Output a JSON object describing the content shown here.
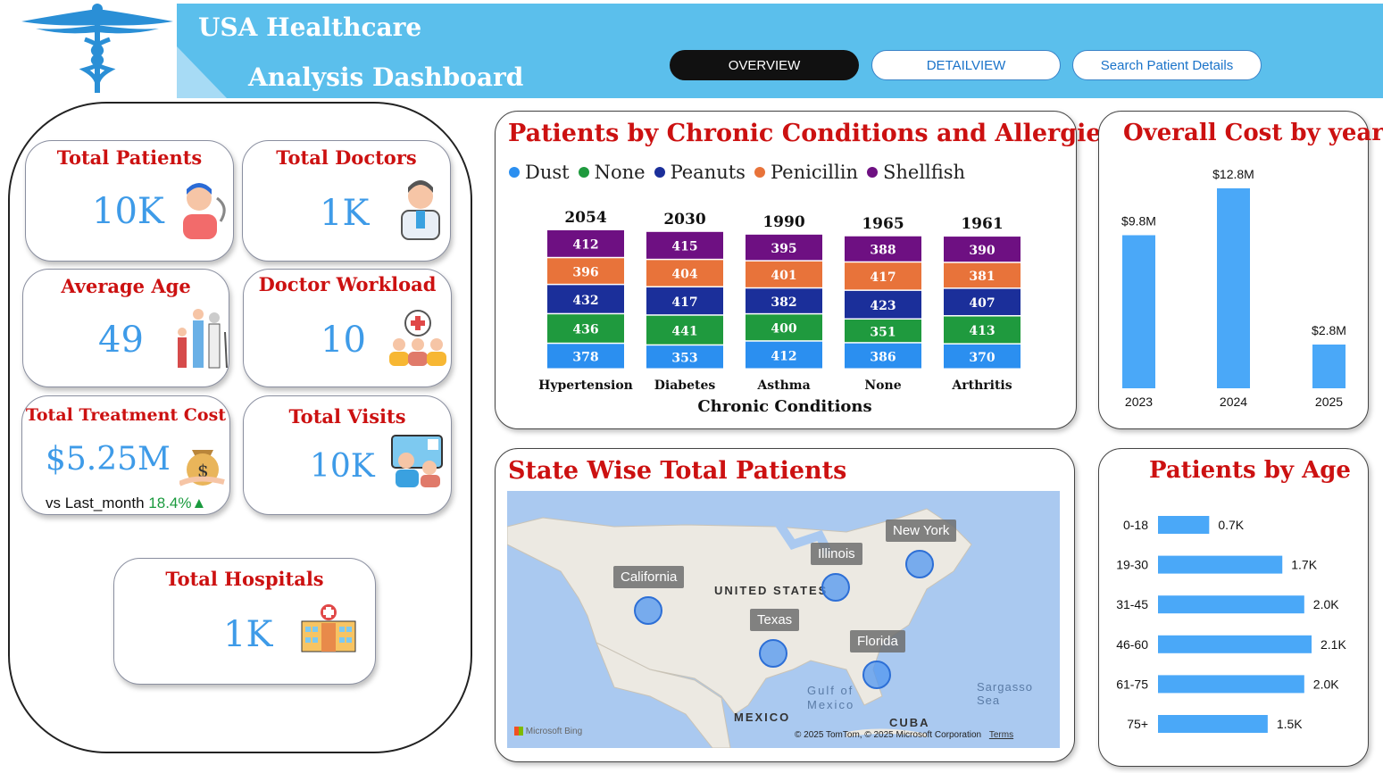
{
  "header": {
    "title_line1": "USA Healthcare",
    "title_line2": "Analysis Dashboard",
    "nav": {
      "overview": "OVERVIEW",
      "detailview": "DETAILVIEW",
      "search": "Search Patient Details"
    }
  },
  "kpis": {
    "total_patients": {
      "label": "Total Patients",
      "value": "10K"
    },
    "total_doctors": {
      "label": "Total Doctors",
      "value": "1K"
    },
    "average_age": {
      "label": "Average Age",
      "value": "49"
    },
    "doctor_workload": {
      "label": "Doctor Workload",
      "value": "10"
    },
    "total_treatment_cost": {
      "label": "Total Treatment Cost",
      "value": "$5.25M",
      "comparison_label": "vs Last_month",
      "comparison_value": "18.4%▲"
    },
    "total_visits": {
      "label": "Total Visits",
      "value": "10K"
    },
    "total_hospitals": {
      "label": "Total Hospitals",
      "value": "1K"
    }
  },
  "colors": {
    "Dust": "#2b8ff0",
    "None": "#1f9a3e",
    "Peanuts": "#1b2f9a",
    "Penicillin": "#e8733a",
    "Shellfish": "#6e1082",
    "bar_blue": "#4aa8f8",
    "accent_red": "#cc1111",
    "header_blue": "#5bbfec"
  },
  "chart_data": [
    {
      "type": "bar",
      "stacked": true,
      "title": "Patients by Chronic Conditions and Allergies",
      "xlabel": "Chronic Conditions",
      "categories": [
        "Hypertension",
        "Diabetes",
        "Asthma",
        "None",
        "Arthritis"
      ],
      "totals": [
        "2054",
        "2030",
        "1990",
        "1965",
        "1961"
      ],
      "series": [
        {
          "name": "Dust",
          "values": [
            378,
            353,
            412,
            386,
            370
          ]
        },
        {
          "name": "None",
          "values": [
            436,
            441,
            400,
            351,
            413
          ]
        },
        {
          "name": "Peanuts",
          "values": [
            432,
            417,
            382,
            423,
            407
          ]
        },
        {
          "name": "Penicillin",
          "values": [
            396,
            404,
            401,
            417,
            381
          ]
        },
        {
          "name": "Shellfish",
          "values": [
            412,
            415,
            395,
            388,
            390
          ]
        }
      ],
      "legend": "top-left"
    },
    {
      "type": "bar",
      "title": "Overall Cost by year",
      "categories": [
        "2023",
        "2024",
        "2025"
      ],
      "values": [
        9.8,
        12.8,
        2.8
      ],
      "value_labels": [
        "$9.8M",
        "$12.8M",
        "$2.8M"
      ]
    },
    {
      "type": "bar",
      "orientation": "horizontal",
      "title": "Patients by Age",
      "categories": [
        "0-18",
        "19-30",
        "31-45",
        "46-60",
        "61-75",
        "75+"
      ],
      "values": [
        0.7,
        1.7,
        2.0,
        2.1,
        2.0,
        1.5
      ],
      "value_labels": [
        "0.7K",
        "1.7K",
        "2.0K",
        "2.1K",
        "2.0K",
        "1.5K"
      ]
    }
  ],
  "map": {
    "title": "State Wise Total Patients",
    "states": [
      "California",
      "Illinois",
      "New York",
      "Texas",
      "Florida"
    ],
    "country_label": "UNITED STATES",
    "place_labels": [
      "Gulf of",
      "Mexico",
      "MEXICO",
      "CUBA",
      "Sargasso Sea"
    ],
    "attribution": "© 2025 TomTom, © 2025 Microsoft Corporation",
    "terms": "Terms",
    "provider": "Microsoft Bing"
  }
}
